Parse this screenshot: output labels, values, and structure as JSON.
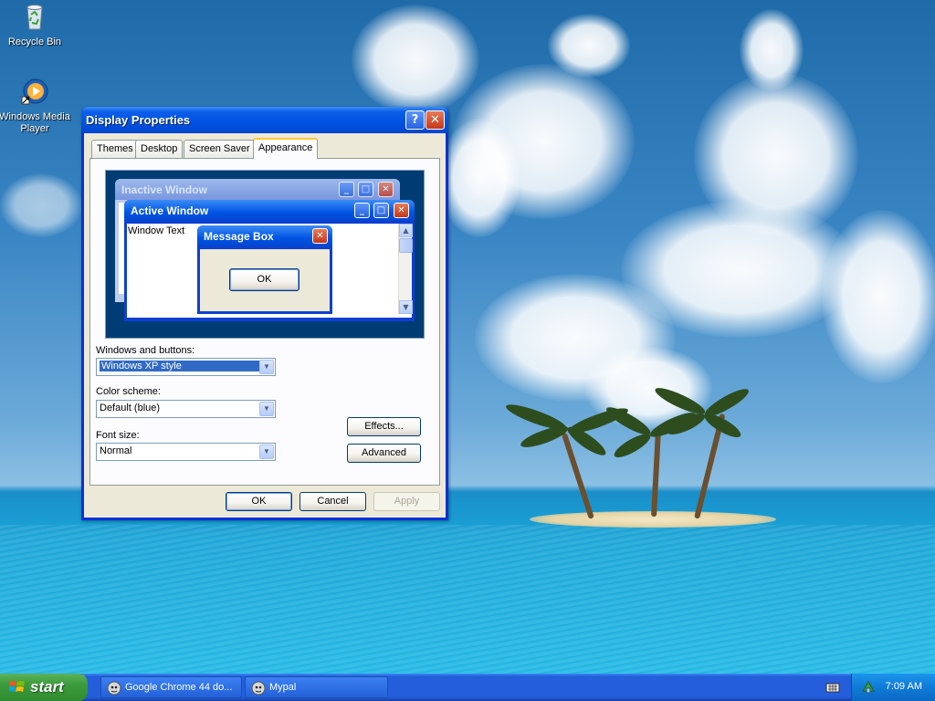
{
  "desktop": {
    "icons": [
      {
        "label": "Recycle Bin",
        "icon": "recycle-bin-icon"
      },
      {
        "label": "Windows Media Player",
        "icon": "media-player-icon"
      }
    ]
  },
  "dialog": {
    "title": "Display Properties",
    "tabs": [
      "Themes",
      "Desktop",
      "Screen Saver",
      "Appearance"
    ],
    "active_tab": "Appearance",
    "preview": {
      "inactive_title": "Inactive Window",
      "active_title": "Active Window",
      "window_text": "Window Text",
      "message_box_title": "Message Box",
      "message_box_ok": "OK"
    },
    "fields": {
      "windows_buttons_label": "Windows and buttons:",
      "windows_buttons_value": "Windows XP style",
      "color_scheme_label": "Color scheme:",
      "color_scheme_value": "Default (blue)",
      "font_size_label": "Font size:",
      "font_size_value": "Normal"
    },
    "buttons": {
      "effects": "Effects...",
      "advanced": "Advanced",
      "ok": "OK",
      "cancel": "Cancel",
      "apply": "Apply"
    }
  },
  "taskbar": {
    "start_label": "start",
    "tasks": [
      {
        "label": "Google Chrome 44 do...",
        "icon": "chrome-app-icon"
      },
      {
        "label": "Mypal",
        "icon": "mypal-app-icon"
      }
    ],
    "clock": "7:09 AM"
  },
  "colors": {
    "titlebar_blue": "#0054e3",
    "dialog_face": "#ece9d8",
    "taskbar_blue": "#245edb",
    "start_green": "#3c9b3c",
    "close_red": "#c5371b",
    "selection_blue": "#316ac5"
  }
}
